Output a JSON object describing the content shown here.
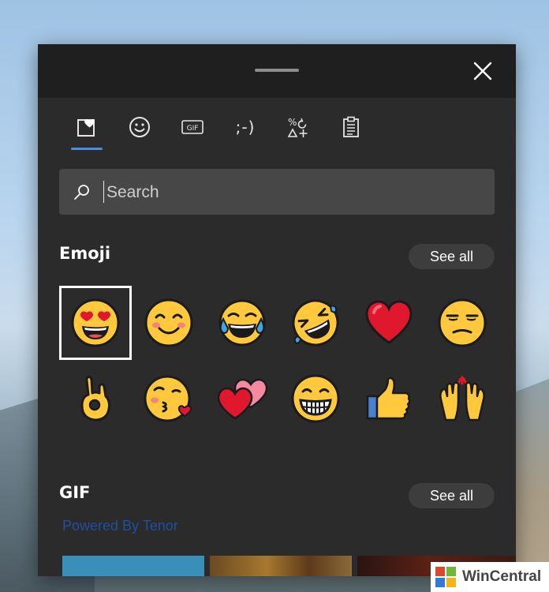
{
  "tabs": [
    {
      "id": "favorites",
      "icon": "heart-clipboard-icon",
      "active": true
    },
    {
      "id": "emoji",
      "icon": "smiley-icon"
    },
    {
      "id": "gif",
      "icon": "gif-icon",
      "label": "GIF"
    },
    {
      "id": "kaomoji",
      "icon": "kaomoji-icon",
      "label": ";-)"
    },
    {
      "id": "symbols",
      "icon": "symbols-icon"
    },
    {
      "id": "clipboard",
      "icon": "clipboard-icon"
    }
  ],
  "search": {
    "placeholder": "Search"
  },
  "emoji_section": {
    "title": "Emoji",
    "see_all": "See all"
  },
  "emoji": [
    {
      "name": "heart-eyes-emoji",
      "glyph": "😍"
    },
    {
      "name": "smiling-blush-emoji",
      "glyph": "😊"
    },
    {
      "name": "tears-of-joy-emoji",
      "glyph": "😂"
    },
    {
      "name": "rolling-laughing-emoji",
      "glyph": "🤣"
    },
    {
      "name": "red-heart-emoji",
      "glyph": "❤"
    },
    {
      "name": "unamused-emoji",
      "glyph": "😒"
    },
    {
      "name": "ok-hand-emoji",
      "glyph": "👌"
    },
    {
      "name": "kissing-heart-emoji",
      "glyph": "😘"
    },
    {
      "name": "two-hearts-emoji",
      "glyph": "💕"
    },
    {
      "name": "grinning-teeth-emoji",
      "glyph": "😁"
    },
    {
      "name": "thumbs-up-emoji",
      "glyph": "👍"
    },
    {
      "name": "raising-hands-emoji",
      "glyph": "🙌"
    }
  ],
  "gif_section": {
    "title": "GIF",
    "see_all": "See all",
    "powered_by": "Powered By Tenor"
  },
  "watermark": {
    "text": "WinCentral"
  },
  "colors": {
    "panel": "#2b2b2b",
    "titlebar": "#1f1f1f",
    "accent": "#4c8ed9",
    "search_bg": "#474747",
    "pill_bg": "#3d3d3d",
    "emoji_yellow": "#ffc83d",
    "heart_red": "#e0182d"
  }
}
